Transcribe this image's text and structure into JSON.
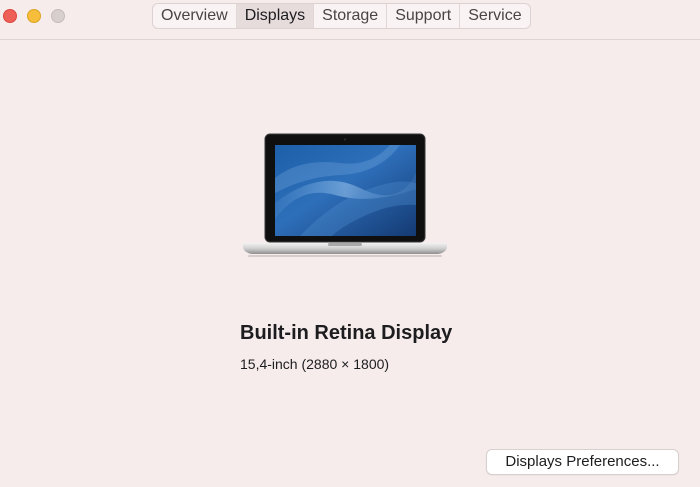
{
  "window": {
    "controls": {
      "close": "close-icon",
      "minimize": "minimize-icon",
      "zoom": "zoom-icon"
    }
  },
  "tabs": [
    {
      "label": "Overview",
      "active": false
    },
    {
      "label": "Displays",
      "active": true
    },
    {
      "label": "Storage",
      "active": false
    },
    {
      "label": "Support",
      "active": false
    },
    {
      "label": "Service",
      "active": false
    }
  ],
  "display": {
    "icon": "macbook-pro-icon",
    "name": "Built-in Retina Display",
    "spec": "15,4-inch (2880 × 1800)"
  },
  "actions": {
    "preferences_label": "Displays Preferences..."
  },
  "colors": {
    "background": "#f6ecec",
    "close": "#ee5f57",
    "minimize": "#f6be3b",
    "zoom_inactive": "#d7cece",
    "active_tab": "#e7dcdc"
  }
}
